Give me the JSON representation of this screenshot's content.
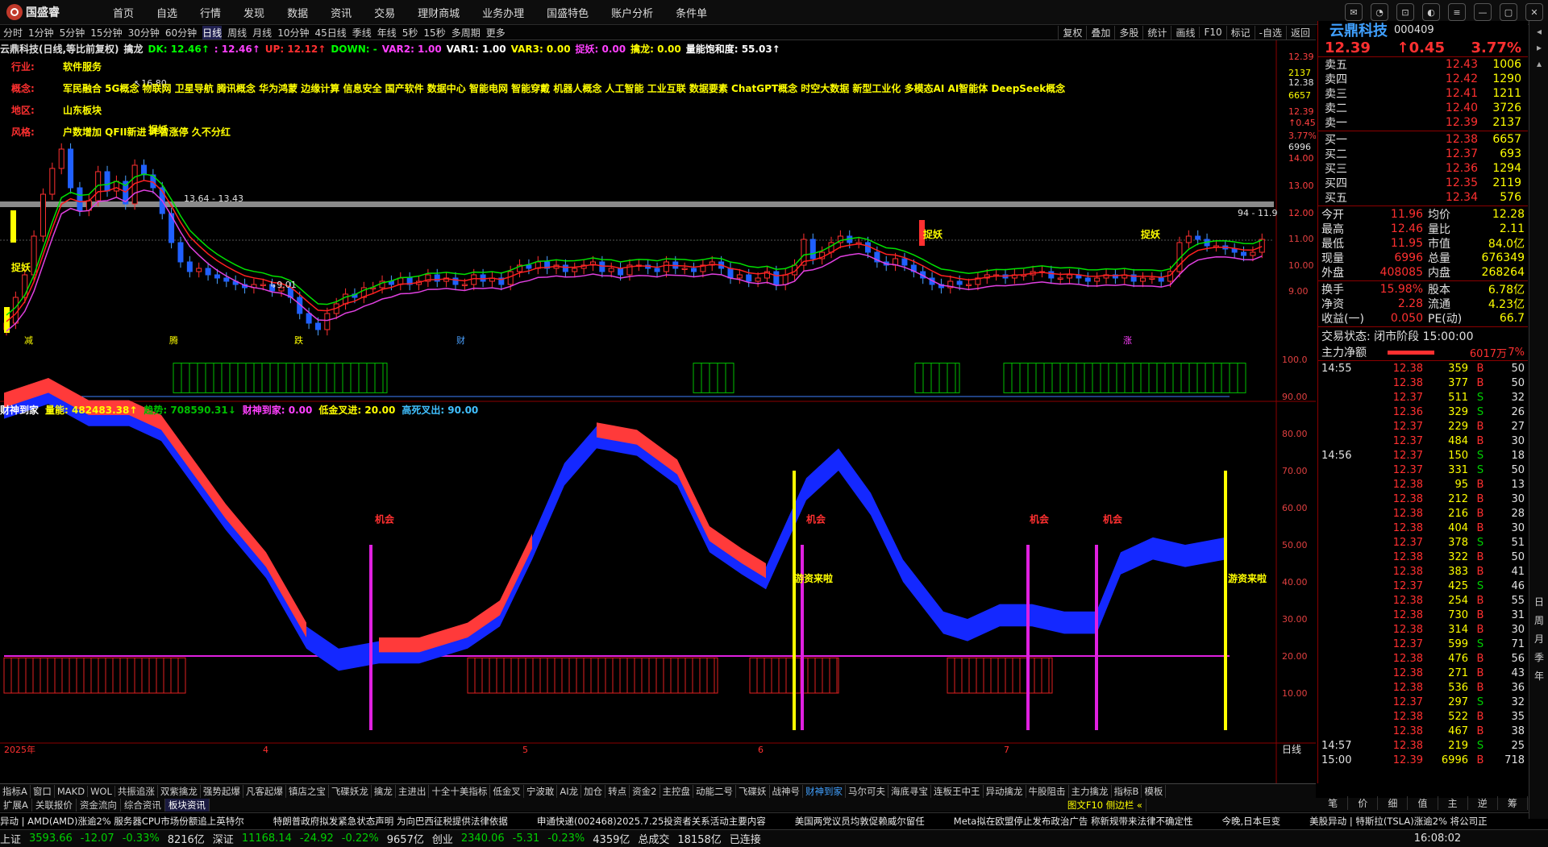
{
  "app": {
    "logo_text": "国盛睿"
  },
  "menu": [
    "首页",
    "自选",
    "行情",
    "发现",
    "数据",
    "资讯",
    "交易",
    "理财商城",
    "业务办理",
    "国盛特色",
    "账户分析",
    "条件单"
  ],
  "periods": [
    "分时",
    "1分钟",
    "5分钟",
    "15分钟",
    "30分钟",
    "60分钟",
    "日线",
    "周线",
    "月线",
    "10分钟",
    "45日线",
    "季线",
    "年线",
    "5秒",
    "15秒",
    "多周期",
    "更多"
  ],
  "active_period": "日线",
  "right_tools": [
    "复权",
    "叠加",
    "多股",
    "统计",
    "画线",
    "F10",
    "标记",
    "-自选",
    "返回"
  ],
  "main_indicator": {
    "title": "云鼎科技(日线,等比前复权)",
    "name": "擒龙",
    "items": [
      {
        "text": "DK: 12.46↑",
        "color": "#00ff00"
      },
      {
        "text": ": 12.46↑",
        "color": "#ff40ff"
      },
      {
        "text": "UP: 12.12↑",
        "color": "#ff3030"
      },
      {
        "text": "DOWN: -",
        "color": "#00ff00"
      },
      {
        "text": "VAR2: 1.00",
        "color": "#ff40ff"
      },
      {
        "text": "VAR1: 1.00",
        "color": "#ffffff"
      },
      {
        "text": "VAR3: 0.00",
        "color": "#ffff00"
      },
      {
        "text": "捉妖: 0.00",
        "color": "#ff40ff"
      },
      {
        "text": "擒龙: 0.00",
        "color": "#ffff00"
      },
      {
        "text": "量能饱和度: 55.03↑",
        "color": "#ffffff"
      }
    ]
  },
  "stock_info": [
    {
      "label": "行业:",
      "value": "软件服务"
    },
    {
      "label": "概念:",
      "value": "军民融合 5G概念 物联网 卫星导航 腾讯概念 华为鸿蒙 边缘计算 信息安全 国产软件 数据中心 智能电网 智能穿戴 机器人概念 人工智能 工业互联 数据要素 ChatGPT概念 时空大数据 新型工业化 多模态AI AI智能体 DeepSeek概念"
    },
    {
      "label": "地区:",
      "value": "山东板块"
    },
    {
      "label": "风格:",
      "value": "户数增加 QFII新进 昨曾涨停 久不分红"
    }
  ],
  "main_axis": {
    "labels": [
      "12.39",
      "2137",
      "12.38",
      "6657",
      "12.39",
      "↑0.45",
      "3.77%",
      "6996",
      "14.00",
      "13.00",
      "12.00",
      "11.00",
      "10.00",
      "9.00"
    ]
  },
  "main_annotations": {
    "high": "16.80",
    "low": "9.01",
    "range": "13.64 - 13.43",
    "right_price": "94 - 11.9",
    "tags": [
      "捉妖",
      "捉妖",
      "捉妖",
      "捉妖"
    ],
    "bottom_marks": [
      "减",
      "腾",
      "跌",
      "财",
      "涨"
    ]
  },
  "sub_indicator": {
    "name": "财神到家",
    "items": [
      {
        "text": "财神到家",
        "color": "#ffffff"
      },
      {
        "text": "量能: 482483.38↑",
        "color": "#ffff00"
      },
      {
        "text": "趋势: 708590.31↓",
        "color": "#00c000"
      },
      {
        "text": "财神到家: 0.00",
        "color": "#ff40ff"
      },
      {
        "text": "低金叉进: 20.00",
        "color": "#ffff00"
      },
      {
        "text": "高死叉出: 90.00",
        "color": "#40c0ff"
      }
    ],
    "axis": [
      "100.0",
      "90.00",
      "80.00",
      "70.00",
      "60.00",
      "50.00",
      "40.00",
      "30.00",
      "20.00",
      "10.00"
    ],
    "labels": [
      "机会",
      "机会",
      "机会",
      "机会",
      "游资来啦",
      "游资来啦"
    ]
  },
  "x_axis": [
    "2025年",
    "4",
    "5",
    "6",
    "7"
  ],
  "right_panel": {
    "name": "云鼎科技",
    "code": "000409",
    "price": "12.39",
    "change": "↑0.45",
    "pct": "3.77%",
    "asks": [
      {
        "l": "卖五",
        "p": "12.43",
        "v": "1006"
      },
      {
        "l": "卖四",
        "p": "12.42",
        "v": "1290"
      },
      {
        "l": "卖三",
        "p": "12.41",
        "v": "1211"
      },
      {
        "l": "卖二",
        "p": "12.40",
        "v": "3726"
      },
      {
        "l": "卖一",
        "p": "12.39",
        "v": "2137"
      }
    ],
    "bids": [
      {
        "l": "买一",
        "p": "12.38",
        "v": "6657"
      },
      {
        "l": "买二",
        "p": "12.37",
        "v": "693"
      },
      {
        "l": "买三",
        "p": "12.36",
        "v": "1294"
      },
      {
        "l": "买四",
        "p": "12.35",
        "v": "2119"
      },
      {
        "l": "买五",
        "p": "12.34",
        "v": "576"
      }
    ],
    "stats": [
      {
        "a": "今开",
        "b": "11.96",
        "c": "均价",
        "d": "12.28"
      },
      {
        "a": "最高",
        "b": "12.46",
        "c": "量比",
        "d": "2.11"
      },
      {
        "a": "最低",
        "b": "11.95",
        "c": "市值",
        "d": "84.0亿"
      },
      {
        "a": "现量",
        "b": "6996",
        "c": "总量",
        "d": "676349"
      },
      {
        "a": "外盘",
        "b": "408085",
        "c": "内盘",
        "d": "268264"
      }
    ],
    "stats2": [
      {
        "a": "换手",
        "b": "15.98%",
        "c": "股本",
        "d": "6.78亿"
      },
      {
        "a": "净资",
        "b": "2.28",
        "c": "流通",
        "d": "4.23亿"
      },
      {
        "a": "收益(一)",
        "b": "0.050",
        "c": "PE(动)",
        "d": "66.7"
      }
    ],
    "trade_state": "交易状态: 闭市阶段 15:00:00",
    "main_net_label": "主力净额",
    "main_net_value": "6017万",
    "main_net_pct": "7%",
    "ticks": [
      {
        "t": "14:55",
        "p": "12.38",
        "v": "359",
        "s": "B",
        "n": "50"
      },
      {
        "t": "",
        "p": "12.38",
        "v": "377",
        "s": "B",
        "n": "50"
      },
      {
        "t": "",
        "p": "12.37",
        "v": "511",
        "s": "S",
        "n": "32"
      },
      {
        "t": "",
        "p": "12.36",
        "v": "329",
        "s": "S",
        "n": "26"
      },
      {
        "t": "",
        "p": "12.37",
        "v": "229",
        "s": "B",
        "n": "27"
      },
      {
        "t": "",
        "p": "12.37",
        "v": "484",
        "s": "B",
        "n": "30"
      },
      {
        "t": "14:56",
        "p": "12.37",
        "v": "150",
        "s": "S",
        "n": "18"
      },
      {
        "t": "",
        "p": "12.37",
        "v": "331",
        "s": "S",
        "n": "50"
      },
      {
        "t": "",
        "p": "12.38",
        "v": "95",
        "s": "B",
        "n": "13"
      },
      {
        "t": "",
        "p": "12.38",
        "v": "212",
        "s": "B",
        "n": "30"
      },
      {
        "t": "",
        "p": "12.38",
        "v": "216",
        "s": "B",
        "n": "28"
      },
      {
        "t": "",
        "p": "12.38",
        "v": "404",
        "s": "B",
        "n": "30"
      },
      {
        "t": "",
        "p": "12.37",
        "v": "378",
        "s": "S",
        "n": "51"
      },
      {
        "t": "",
        "p": "12.38",
        "v": "322",
        "s": "B",
        "n": "50"
      },
      {
        "t": "",
        "p": "12.38",
        "v": "383",
        "s": "B",
        "n": "41"
      },
      {
        "t": "",
        "p": "12.37",
        "v": "425",
        "s": "S",
        "n": "46"
      },
      {
        "t": "",
        "p": "12.38",
        "v": "254",
        "s": "B",
        "n": "55"
      },
      {
        "t": "",
        "p": "12.38",
        "v": "730",
        "s": "B",
        "n": "31"
      },
      {
        "t": "",
        "p": "12.38",
        "v": "314",
        "s": "B",
        "n": "30"
      },
      {
        "t": "",
        "p": "12.37",
        "v": "599",
        "s": "S",
        "n": "71"
      },
      {
        "t": "",
        "p": "12.38",
        "v": "476",
        "s": "B",
        "n": "56"
      },
      {
        "t": "",
        "p": "12.38",
        "v": "271",
        "s": "B",
        "n": "43"
      },
      {
        "t": "",
        "p": "12.38",
        "v": "536",
        "s": "B",
        "n": "36"
      },
      {
        "t": "",
        "p": "12.37",
        "v": "297",
        "s": "S",
        "n": "32"
      },
      {
        "t": "",
        "p": "12.38",
        "v": "522",
        "s": "B",
        "n": "35"
      },
      {
        "t": "",
        "p": "12.38",
        "v": "467",
        "s": "B",
        "n": "38"
      },
      {
        "t": "14:57",
        "p": "12.38",
        "v": "219",
        "s": "S",
        "n": "25"
      },
      {
        "t": "15:00",
        "p": "12.39",
        "v": "6996",
        "s": "B",
        "n": "718"
      }
    ],
    "bottom_tabs": [
      "笔",
      "价",
      "细",
      "值",
      "主",
      "逆",
      "筹"
    ]
  },
  "side_tabs": [
    "日",
    "周",
    "月",
    "季",
    "年"
  ],
  "axis_corner": "日线",
  "indicator_tabs": [
    "指标A",
    "窗口",
    "MAKD",
    "WOL",
    "共振追涨",
    "双紫擒龙",
    "强势起爆",
    "凡客起爆",
    "镇店之宝",
    "飞碟妖龙",
    "擒龙",
    "主进出",
    "十全十美指标",
    "低金叉",
    "宁波敢",
    "AI龙",
    "加仓",
    "转点",
    "资金2",
    "主控盘",
    "动能二号",
    "飞碟妖",
    "战神号",
    "财神到家",
    "马尔可夫",
    "海底寻宝",
    "连板王中王",
    "异动擒龙",
    "牛股阻击",
    "主力擒龙",
    "指标B",
    "模板"
  ],
  "active_indicator": "财神到家",
  "extra_tabs": [
    "扩展A",
    "关联报价",
    "资金流向",
    "综合资讯",
    "板块资讯"
  ],
  "active_extra": "板块资讯",
  "extra_right": "图文F10 侧边栏 «",
  "news": [
    "异动 | AMD(AMD)涨逾2% 服务器CPU市场份额追上英特尔",
    "特朗普政府拟发紧急状态声明 为向巴西征税提供法律依据",
    "申通快递(002468)2025.7.25投资者关系活动主要内容",
    "美国两党议员均敦促赖威尔留任",
    "Meta拟在欧盟停止发布政治广告 称新规带来法律不确定性",
    "今晚,日本巨变",
    "美股异动 | 特斯拉(TSLA)涨逾2% 将公司正"
  ],
  "status": {
    "sh_label": "上证",
    "sh_val": "3593.66",
    "sh_chg": "-12.07",
    "sh_pct": "-0.33%",
    "sh_amt": "8216亿",
    "sz_label": "深证",
    "sz_val": "11168.14",
    "sz_chg": "-24.92",
    "sz_pct": "-0.22%",
    "sz_amt": "9657亿",
    "cy_label": "创业",
    "cy_val": "2340.06",
    "cy_chg": "-5.31",
    "cy_pct": "-0.23%",
    "cy_amt": "4359亿",
    "total_label": "总成交",
    "total_val": "18158亿",
    "conn": "已连接",
    "time": "16:08:02"
  },
  "colors": {
    "up": "#ff3030",
    "down": "#00d000",
    "accent": "#ffff00",
    "ribbon_up": "#ff3a3a",
    "ribbon_down": "#1428ff"
  }
}
